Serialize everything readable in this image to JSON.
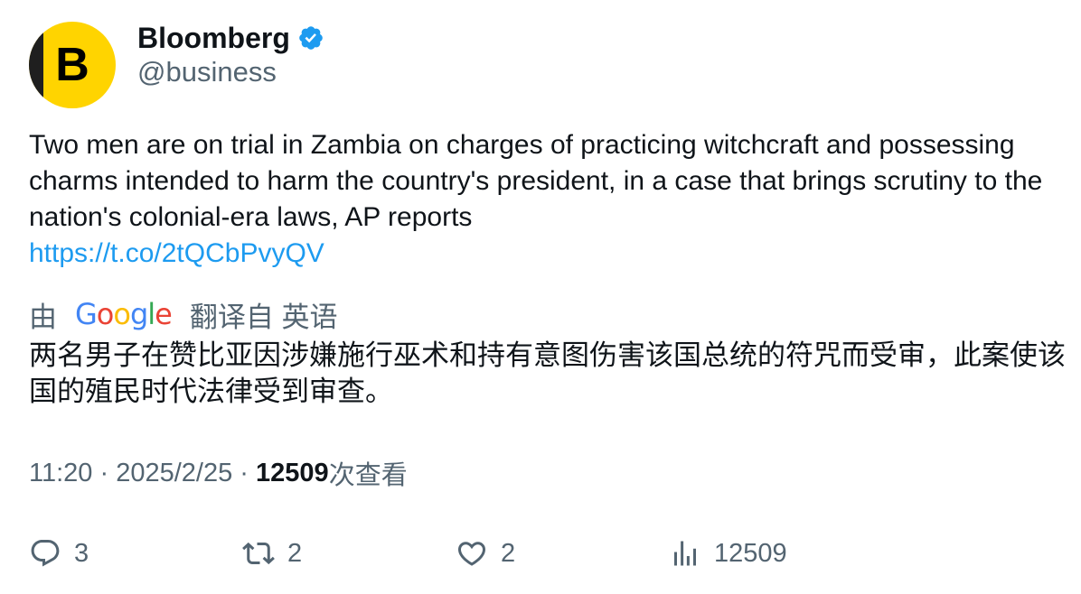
{
  "author": {
    "avatar_letter": "B",
    "display_name": "Bloomberg",
    "handle": "@business",
    "verified": true,
    "brand_color": "#ffd400",
    "verified_color": "#1d9bf0"
  },
  "tweet": {
    "text": "Two men are on trial in Zambia on charges of practicing witchcraft and possessing charms intended to harm the country's president, in a case that brings scrutiny to the nation's colonial-era laws, AP reports",
    "link": "https://t.co/2tQCbPvyQV",
    "link_color": "#1d9bf0"
  },
  "translation": {
    "prefix": "由",
    "provider": "Google",
    "suffix": "翻译自 英语",
    "text": "两名男子在赞比亚因涉嫌施行巫术和持有意图伤害该国总统的符咒而受审，此案使该国的殖民时代法律受到审查。"
  },
  "meta": {
    "time": "11:20",
    "separator": "·",
    "date": "2025/2/25",
    "views_count": "12509",
    "views_label": "次查看"
  },
  "actions": {
    "reply": {
      "icon": "reply-icon",
      "count": "3"
    },
    "retweet": {
      "icon": "retweet-icon",
      "count": "2"
    },
    "like": {
      "icon": "heart-icon",
      "count": "2"
    },
    "views": {
      "icon": "views-icon",
      "count": "12509"
    }
  }
}
